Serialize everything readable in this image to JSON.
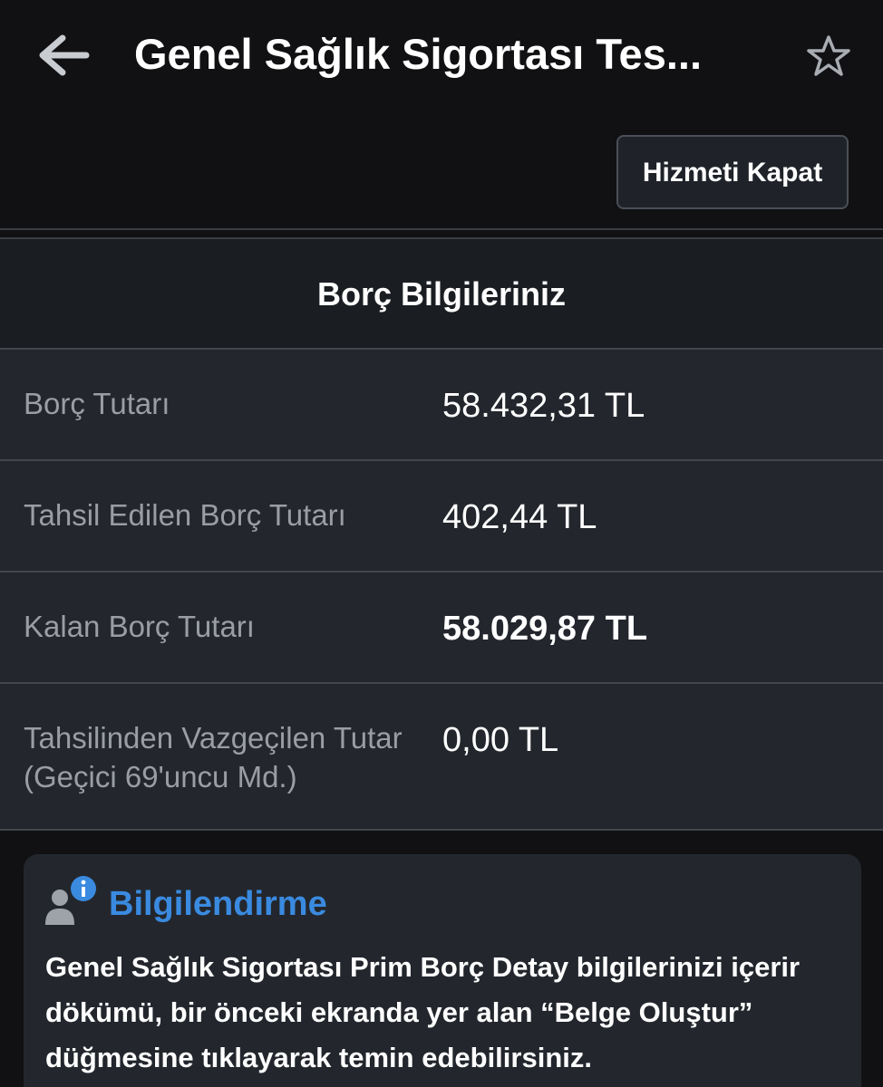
{
  "header": {
    "title": "Genel Sağlık Sigortası Tes...",
    "back_icon": "arrow-left-icon",
    "favorite_icon": "star-outline-icon"
  },
  "actions": {
    "close_service_label": "Hizmeti Kapat"
  },
  "debt": {
    "title": "Borç Bilgileriniz",
    "rows": [
      {
        "label": "Borç Tutarı",
        "value": "58.432,31 TL"
      },
      {
        "label": "Tahsil Edilen Borç Tutarı",
        "value": "402,44 TL"
      },
      {
        "label": "Kalan Borç Tutarı",
        "value": "58.029,87 TL"
      },
      {
        "label": "Tahsilinden Vazgeçilen Tutar (Geçici 69'uncu Md.)",
        "value": "0,00 TL"
      }
    ]
  },
  "info": {
    "icon": "user-info-icon",
    "heading": "Bilgilendirme",
    "text": "Genel Sağlık Sigortası Prim Borç Detay bilgilerinizi içerir dökümü, bir önceki ekranda yer alan “Belge Oluştur” düğmesine tıklayarak temin edebilirsiniz."
  },
  "colors": {
    "background": "#111113",
    "panel": "#23272d",
    "accent": "#3a8ae0",
    "label": "#9a9ea4"
  }
}
